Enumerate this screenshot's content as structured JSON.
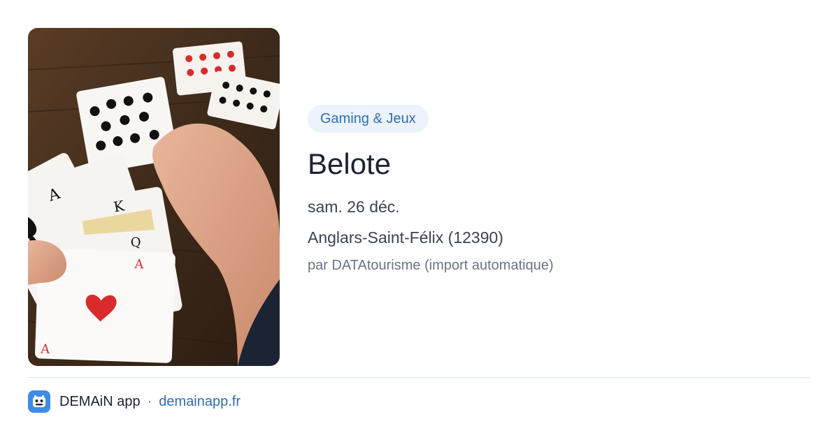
{
  "card": {
    "image_alt": "Cartes à jouer - partie de belote",
    "category": "Gaming & Jeux",
    "title": "Belote",
    "date": "sam. 26 déc.",
    "location": "Anglars-Saint-Félix (12390)",
    "author": "par DATAtourisme (import automatique)"
  },
  "footer": {
    "app_name": "DEMAiN app",
    "separator": "·",
    "site": "demainapp.fr",
    "logo_icon": "demain-app-logo-icon"
  },
  "colors": {
    "tag_bg": "#edf3fb",
    "tag_text": "#2f6db5",
    "link": "#2f6db5",
    "title": "#1b2333",
    "muted": "#6a7484",
    "logo_bg": "#3d8ce8"
  }
}
